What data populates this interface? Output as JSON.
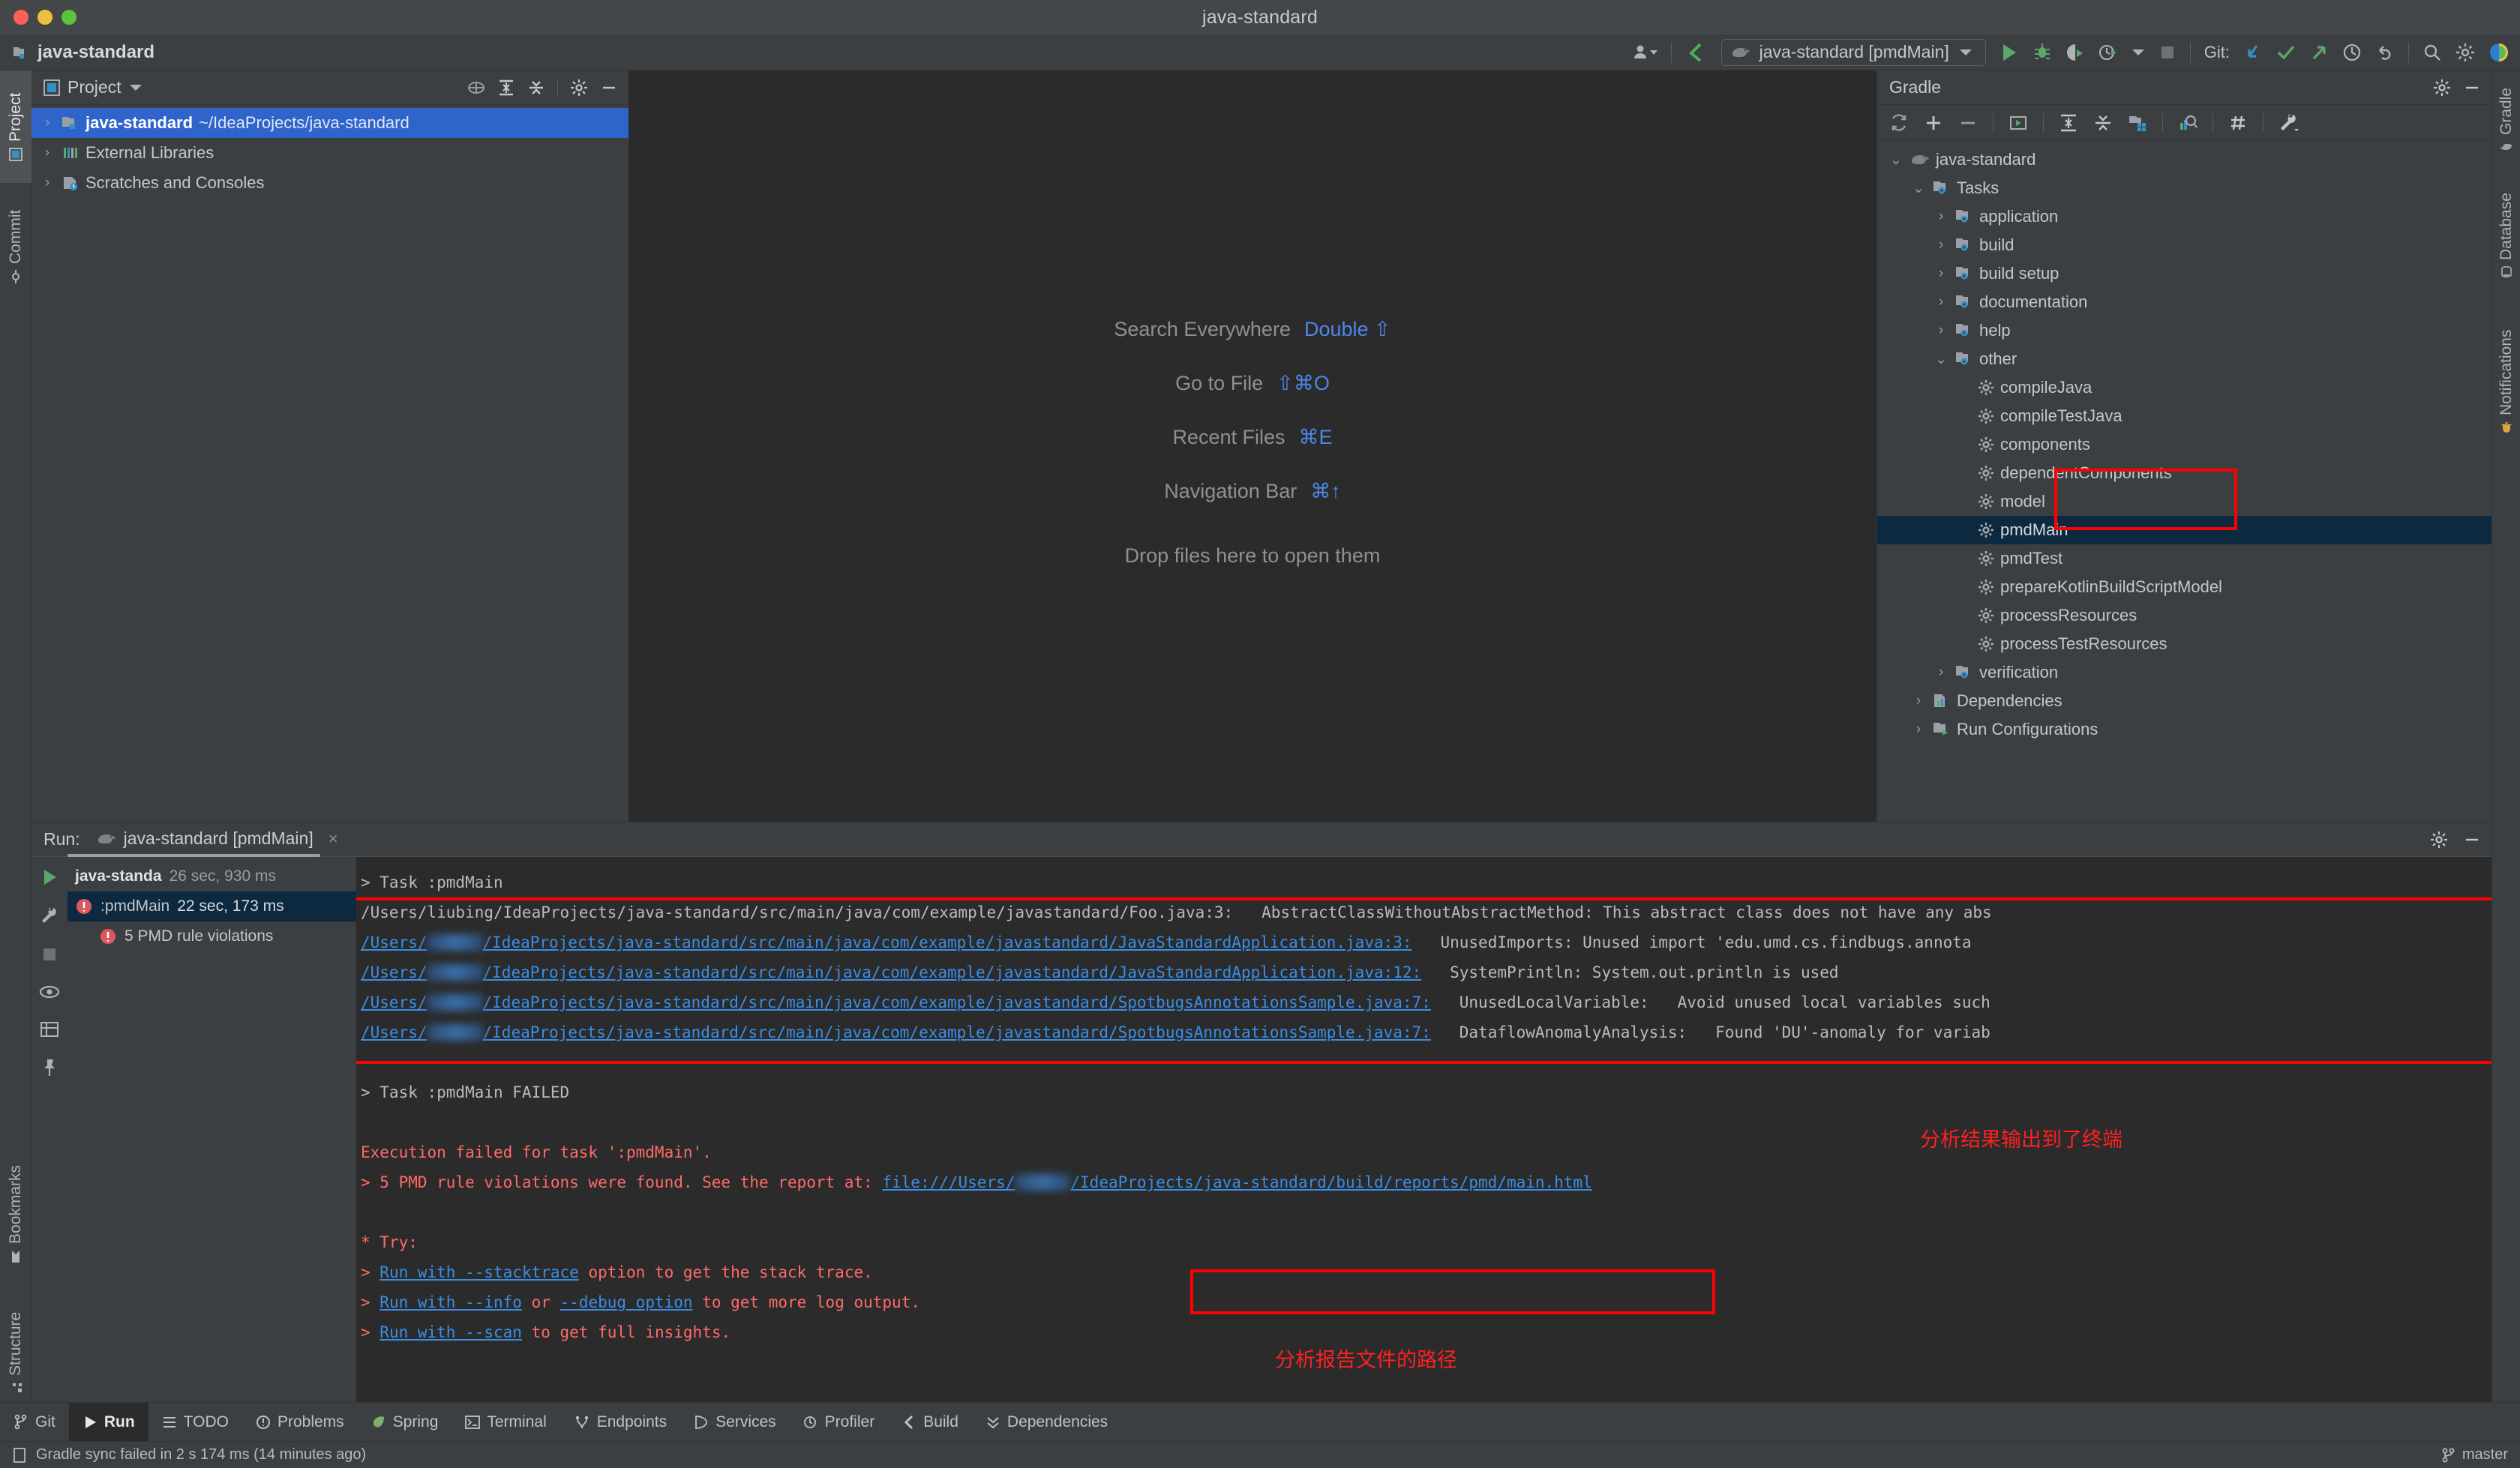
{
  "window": {
    "title": "java-standard",
    "project_name": "java-standard"
  },
  "toolbar": {
    "run_config": "java-standard [pmdMain]",
    "git_label": "Git:",
    "icons": [
      "account-icon",
      "vcs-update-icon",
      "gradle-elephant-icon",
      "chevron-down-icon",
      "run-icon",
      "debug-icon",
      "run-coverage-icon",
      "profile-icon",
      "stop-icon",
      "git-pull-icon",
      "git-commit-icon",
      "git-push-icon",
      "git-history-icon",
      "git-rollback-icon",
      "search-icon",
      "settings-icon",
      "ide-assistant-icon"
    ]
  },
  "left_rail": {
    "tabs": [
      {
        "label": "Project",
        "icon": "project-icon",
        "active": true
      },
      {
        "label": "Commit",
        "icon": "commit-icon",
        "active": false
      },
      {
        "label": "Bookmarks",
        "icon": "bookmarks-icon",
        "active": false
      },
      {
        "label": "Structure",
        "icon": "structure-icon",
        "active": false
      }
    ]
  },
  "right_rail": {
    "tabs": [
      {
        "label": "Gradle",
        "icon": "gradle-icon"
      },
      {
        "label": "Database",
        "icon": "database-icon"
      },
      {
        "label": "Notifications",
        "icon": "notifications-icon"
      }
    ]
  },
  "project_panel": {
    "title": "Project",
    "header_icons": [
      "locate-icon",
      "expand-all-icon",
      "collapse-all-icon",
      "gear-icon",
      "minimize-icon"
    ],
    "tree": [
      {
        "indent": 0,
        "chevron": "›",
        "icon": "project-folder-icon",
        "name": "java-standard",
        "path": "~/IdeaProjects/java-standard",
        "bold": true,
        "selected": true
      },
      {
        "indent": 0,
        "chevron": "›",
        "icon": "external-libraries-icon",
        "name": "External Libraries",
        "path": "",
        "bold": false,
        "selected": false
      },
      {
        "indent": 0,
        "chevron": "›",
        "icon": "scratches-icon",
        "name": "Scratches and Consoles",
        "path": "",
        "bold": false,
        "selected": false
      }
    ]
  },
  "editor": {
    "hints": [
      {
        "label": "Search Everywhere",
        "shortcut": "Double ⇧"
      },
      {
        "label": "Go to File",
        "shortcut": "⇧⌘O"
      },
      {
        "label": "Recent Files",
        "shortcut": "⌘E"
      },
      {
        "label": "Navigation Bar",
        "shortcut": "⌘↑"
      }
    ],
    "drop_text": "Drop files here to open them"
  },
  "gradle_panel": {
    "title": "Gradle",
    "header_icons": [
      "gear-icon",
      "minimize-icon"
    ],
    "toolbar_icons": [
      "refresh-icon",
      "add-icon",
      "remove-icon",
      "execute-task-icon",
      "expand-all-icon",
      "collapse-all-icon",
      "show-modules-icon",
      "task-execution-icon",
      "toggle-offline-icon",
      "wrench-icon"
    ],
    "tree": [
      {
        "indent": 0,
        "chevron": "⌄",
        "icon": "gradle-elephant-icon",
        "name": "java-standard"
      },
      {
        "indent": 1,
        "chevron": "⌄",
        "icon": "task-folder-icon",
        "name": "Tasks"
      },
      {
        "indent": 2,
        "chevron": "›",
        "icon": "task-folder-icon",
        "name": "application"
      },
      {
        "indent": 2,
        "chevron": "›",
        "icon": "task-folder-icon",
        "name": "build"
      },
      {
        "indent": 2,
        "chevron": "›",
        "icon": "task-folder-icon",
        "name": "build setup"
      },
      {
        "indent": 2,
        "chevron": "›",
        "icon": "task-folder-icon",
        "name": "documentation"
      },
      {
        "indent": 2,
        "chevron": "›",
        "icon": "task-folder-icon",
        "name": "help"
      },
      {
        "indent": 2,
        "chevron": "⌄",
        "icon": "task-folder-icon",
        "name": "other"
      },
      {
        "indent": 3,
        "chevron": "",
        "icon": "gear-task-icon",
        "name": "compileJava"
      },
      {
        "indent": 3,
        "chevron": "",
        "icon": "gear-task-icon",
        "name": "compileTestJava"
      },
      {
        "indent": 3,
        "chevron": "",
        "icon": "gear-task-icon",
        "name": "components"
      },
      {
        "indent": 3,
        "chevron": "",
        "icon": "gear-task-icon",
        "name": "dependentComponents"
      },
      {
        "indent": 3,
        "chevron": "",
        "icon": "gear-task-icon",
        "name": "model"
      },
      {
        "indent": 3,
        "chevron": "",
        "icon": "gear-task-icon",
        "name": "pmdMain",
        "selected": true
      },
      {
        "indent": 3,
        "chevron": "",
        "icon": "gear-task-icon",
        "name": "pmdTest"
      },
      {
        "indent": 3,
        "chevron": "",
        "icon": "gear-task-icon",
        "name": "prepareKotlinBuildScriptModel"
      },
      {
        "indent": 3,
        "chevron": "",
        "icon": "gear-task-icon",
        "name": "processResources"
      },
      {
        "indent": 3,
        "chevron": "",
        "icon": "gear-task-icon",
        "name": "processTestResources"
      },
      {
        "indent": 2,
        "chevron": "›",
        "icon": "task-folder-icon",
        "name": "verification"
      },
      {
        "indent": 1,
        "chevron": "›",
        "icon": "dependencies-icon",
        "name": "Dependencies"
      },
      {
        "indent": 1,
        "chevron": "›",
        "icon": "run-configurations-icon",
        "name": "Run Configurations"
      }
    ]
  },
  "run_panel": {
    "label": "Run:",
    "tab_title": "java-standard [pmdMain]",
    "tab_icon": "gradle-elephant-icon",
    "close_icon": "×",
    "header_icons": [
      "gear-icon",
      "minimize-icon"
    ],
    "gutter_icons": [
      "rerun-icon",
      "settings-wrench-icon",
      "stop-icon",
      "eye-icon",
      "chart-icon",
      "pin-icon"
    ],
    "tree": [
      {
        "name": "java-standa",
        "duration": "26 sec, 930 ms",
        "status": "root",
        "selected": false
      },
      {
        "name": ":pmdMain",
        "duration": "22 sec, 173 ms",
        "status": "error",
        "selected": true
      },
      {
        "name": "5 PMD rule violations",
        "duration": "",
        "status": "error",
        "selected": false
      }
    ],
    "console": {
      "task_header": "> Task :pmdMain",
      "violations": [
        {
          "plain_path": "/Users/liubing/IdeaProjects/java-standard/src/main/java/com/example/javastandard/Foo.java:3:",
          "link": false,
          "rule": "AbstractClassWithoutAbstractMethod:",
          "message": "This abstract class does not have any abs"
        },
        {
          "link_prefix": "/Users/",
          "link_suffix": "/IdeaProjects/java-standard/src/main/java/com/example/javastandard/JavaStandardApplication.java:3:",
          "link": true,
          "rule": "UnusedImports:",
          "message": "Unused import 'edu.umd.cs.findbugs.annota"
        },
        {
          "link_prefix": "/Users/",
          "link_suffix": "/IdeaProjects/java-standard/src/main/java/com/example/javastandard/JavaStandardApplication.java:12:",
          "link": true,
          "rule": "SystemPrintln:",
          "message": "System.out.println is used"
        },
        {
          "link_prefix": "/Users/",
          "link_suffix": "/IdeaProjects/java-standard/src/main/java/com/example/javastandard/SpotbugsAnnotationsSample.java:7:",
          "link": true,
          "rule": "UnusedLocalVariable:",
          "message": "Avoid unused local variables such"
        },
        {
          "link_prefix": "/Users/",
          "link_suffix": "/IdeaProjects/java-standard/src/main/java/com/example/javastandard/SpotbugsAnnotationsSample.java:7:",
          "link": true,
          "rule": "DataflowAnomalyAnalysis:",
          "message": "Found 'DU'-anomaly for variab"
        }
      ],
      "task_failed": "> Task :pmdMain FAILED",
      "exec_failed": "Execution failed for task ':pmdMain'.",
      "report_prefix": "> 5 PMD rule violations were found. See the report at: ",
      "report_link_a": "file:///Users/",
      "report_link_b": "/IdeaProjects/java-standard/build/reports/pmd/main.html",
      "try_header": "* Try:",
      "try_items": [
        {
          "prefix": "> ",
          "link1": "Run with --stacktrace",
          "mid": " option to get the stack trace.",
          "link2": "",
          "tail": ""
        },
        {
          "prefix": "> ",
          "link1": "Run with --info",
          "mid": " or ",
          "link2": "--debug option",
          "tail": " to get more log output."
        },
        {
          "prefix": "> ",
          "link1": "Run with --scan",
          "mid": " to get full insights.",
          "link2": "",
          "tail": ""
        }
      ]
    },
    "annotations": [
      {
        "text": "分析结果输出到了终端"
      },
      {
        "text": "分析报告文件的路径"
      }
    ]
  },
  "bottom_bar": {
    "tabs": [
      {
        "label": "Git",
        "icon": "git-icon",
        "active": false
      },
      {
        "label": "Run",
        "icon": "run-icon",
        "active": true
      },
      {
        "label": "TODO",
        "icon": "todo-icon",
        "active": false
      },
      {
        "label": "Problems",
        "icon": "problems-icon",
        "active": false
      },
      {
        "label": "Spring",
        "icon": "spring-icon",
        "active": false
      },
      {
        "label": "Terminal",
        "icon": "terminal-icon",
        "active": false
      },
      {
        "label": "Endpoints",
        "icon": "endpoints-icon",
        "active": false
      },
      {
        "label": "Services",
        "icon": "services-icon",
        "active": false
      },
      {
        "label": "Profiler",
        "icon": "profiler-icon",
        "active": false
      },
      {
        "label": "Build",
        "icon": "build-icon",
        "active": false
      },
      {
        "label": "Dependencies",
        "icon": "dependencies-icon",
        "active": false
      }
    ]
  },
  "status_bar": {
    "message": "Gradle sync failed in 2 s 174 ms (14 minutes ago)",
    "branch": "master",
    "branch_icon": "git-branch-icon",
    "left_icon": "memory-icon"
  },
  "colors": {
    "accent_blue": "#2f65ca",
    "link_blue": "#3a8ee6",
    "error_red": "#ff6b68",
    "annotation_red": "#ff0000",
    "selection_dark": "#0d293f",
    "editor_bg": "#2b2b2b",
    "panel_bg": "#3c3f41"
  }
}
